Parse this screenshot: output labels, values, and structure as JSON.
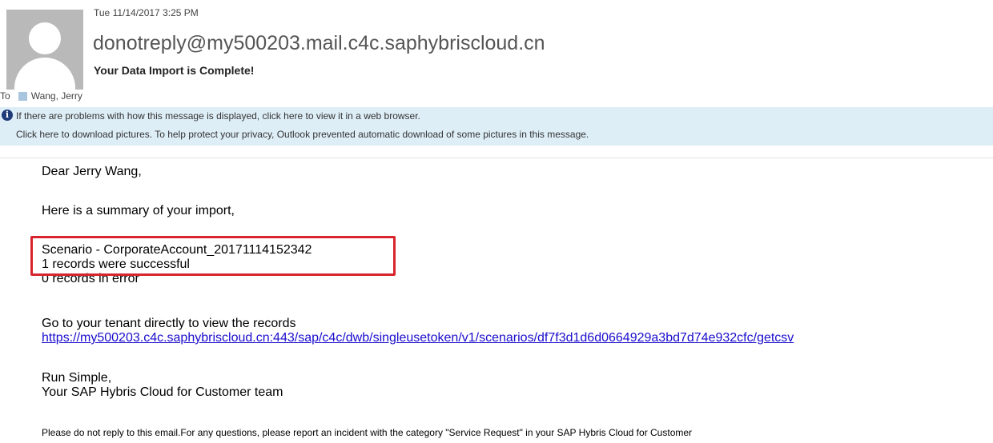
{
  "header": {
    "date": "Tue 11/14/2017 3:25 PM",
    "sender": "donotreply@my500203.mail.c4c.saphybriscloud.cn",
    "subject": "Your Data Import is Complete!",
    "to_label": "To",
    "recipient": "Wang, Jerry",
    "avatar_icon": "person-silhouette-icon"
  },
  "infobar": {
    "icon": "info-icon",
    "line1": "If there are problems with how this message is displayed, click here to view it in a web browser.",
    "line2": "Click here to download pictures. To help protect your privacy, Outlook prevented automatic download of some pictures in this message."
  },
  "body": {
    "greeting": "Dear Jerry Wang,",
    "intro": "Here is a summary of your import,",
    "scenario": "Scenario - CorporateAccount_20171114152342",
    "success": "1 records were successful",
    "errors": "0 records in error",
    "tenant_text": "Go to your tenant directly to view the records",
    "link": "https://my500203.c4c.saphybriscloud.cn:443/sap/c4c/dwb/singleusetoken/v1/scenarios/df7f3d1d6d0664929a3bd7d74e932cfc/getcsv",
    "signoff1": "Run Simple,",
    "signoff2": "Your SAP Hybris Cloud for Customer team",
    "footer": "Please do not reply to this email.For any questions, please report an incident with the category \"Service Request\" in your SAP Hybris Cloud for Customer"
  },
  "colors": {
    "highlight_border": "#d8242c",
    "infobar_bg": "#deeef7",
    "link": "#1a0dcc"
  }
}
